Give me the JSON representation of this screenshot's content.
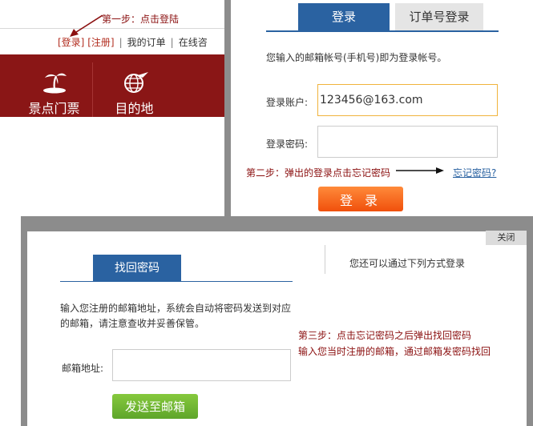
{
  "step1": {
    "text": "第一步：点击登陆"
  },
  "topnav": {
    "login": "[登录]",
    "register": "[注册]",
    "separator": "|",
    "my_orders": "我的订单",
    "online": "在线咨"
  },
  "main_nav": [
    {
      "label": "景点门票",
      "icon": "palm-island-icon"
    },
    {
      "label": "目的地",
      "icon": "globe-plane-icon"
    }
  ],
  "login": {
    "tabs": {
      "login": "登录",
      "order_login": "订单号登录"
    },
    "hint": "您输入的邮箱帐号(手机号)即为登录帐号。",
    "account_label": "登录账户:",
    "account_value": "123456@163.com",
    "password_label": "登录密码:",
    "step2": "第二步：弹出的登录点击忘记密码",
    "forgot_link": "忘记密码?",
    "submit": "登 录"
  },
  "recover": {
    "close": "关闭",
    "tab": "找回密码",
    "alt_login": "您还可以通过下列方式登录",
    "desc": "输入您注册的邮箱地址，系统会自动将密码发送到对应的邮箱，请注意查收并妥善保管。",
    "email_label": "邮箱地址:",
    "step3_line1": "第三步：点击忘记密码之后弹出找回密码",
    "step3_line2": "输入您当时注册的邮箱，通过邮箱发密码找回",
    "send": "发送至邮箱"
  },
  "colors": {
    "brand_red": "#8a1616",
    "tab_blue": "#2a62a1",
    "annotation_red": "#8b1010",
    "login_orange": "#f0500c",
    "send_green": "#5ea52a"
  }
}
